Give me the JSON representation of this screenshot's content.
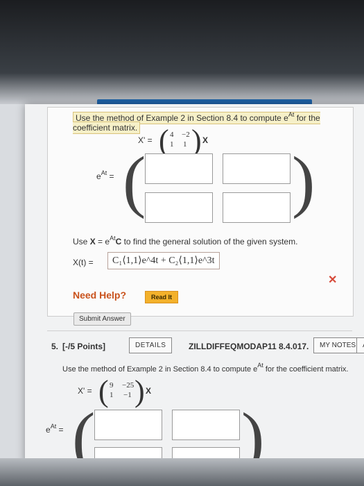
{
  "q4": {
    "instruction": "Use the method of Example 2 in Section 8.4 to compute e",
    "instruction_sup": "At",
    "instruction_tail": " for the coefficient matrix.",
    "xprime_label": "X' =",
    "matrix": [
      "4",
      "−2",
      "1",
      "1"
    ],
    "x_after": "X",
    "eAt_label": "e",
    "eAt_sup": "At",
    "eAt_eq": " =",
    "use_text_a": "Use ",
    "use_bold_x": "X",
    "use_text_b": " = e",
    "use_sup": "At",
    "use_bold_c": "C",
    "use_text_c": " to find the general solution of the given system.",
    "xt_label": "X(t) =",
    "answer": "C₁⟨1,1⟩e^4t + C₂⟨1,1⟩e^3t",
    "answer_status": "✕",
    "need_help": "Need Help?",
    "read_it": "Read It",
    "submit": "Submit Answer"
  },
  "q5": {
    "number": "5.",
    "points": "[-/5 Points]",
    "details": "DETAILS",
    "code": "ZILLDIFFEQMODAP11 8.4.017.",
    "my_notes": "MY NOTES",
    "ask_tab": "AS",
    "instruction": "Use the method of Example 2 in Section 8.4 to compute e",
    "instruction_sup": "At",
    "instruction_tail": " for the coefficient matrix.",
    "xprime_label": "X' =",
    "matrix": [
      "9",
      "−25",
      "1",
      "−1"
    ],
    "x_after": "X",
    "eAt_label": "e",
    "eAt_sup": "At",
    "eAt_eq": " ="
  },
  "colors": {
    "accent_orange": "#c9521c",
    "error_red": "#d64a3a",
    "read_it_bg": "#f3b12b"
  }
}
